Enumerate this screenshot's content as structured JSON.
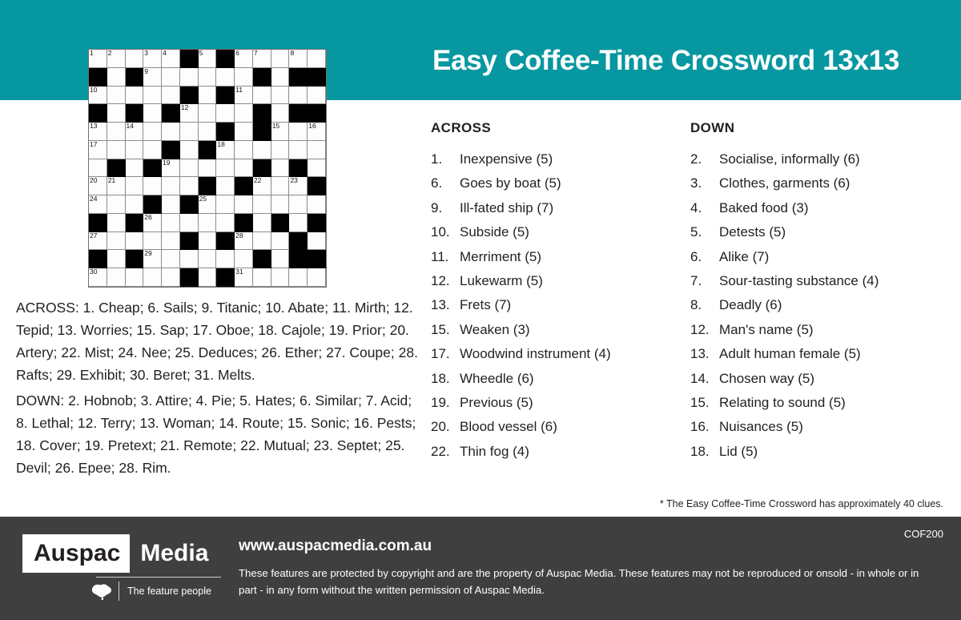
{
  "header": {
    "title": "Easy Coffee-Time Crossword 13x13",
    "background_color": "#0797a0"
  },
  "grid": {
    "size": 13,
    "black_cells": [
      [
        0,
        5
      ],
      [
        0,
        7
      ],
      [
        1,
        0
      ],
      [
        1,
        2
      ],
      [
        1,
        9
      ],
      [
        1,
        11
      ],
      [
        1,
        12
      ],
      [
        2,
        5
      ],
      [
        2,
        7
      ],
      [
        3,
        0
      ],
      [
        3,
        2
      ],
      [
        3,
        4
      ],
      [
        3,
        9
      ],
      [
        3,
        11
      ],
      [
        3,
        12
      ],
      [
        4,
        7
      ],
      [
        4,
        9
      ],
      [
        5,
        4
      ],
      [
        5,
        6
      ],
      [
        6,
        1
      ],
      [
        6,
        3
      ],
      [
        6,
        9
      ],
      [
        6,
        11
      ],
      [
        7,
        6
      ],
      [
        7,
        8
      ],
      [
        7,
        12
      ],
      [
        8,
        3
      ],
      [
        8,
        5
      ],
      [
        9,
        0
      ],
      [
        9,
        2
      ],
      [
        9,
        8
      ],
      [
        9,
        10
      ],
      [
        9,
        12
      ],
      [
        10,
        5
      ],
      [
        10,
        7
      ],
      [
        10,
        11
      ],
      [
        11,
        0
      ],
      [
        11,
        2
      ],
      [
        11,
        9
      ],
      [
        11,
        11
      ],
      [
        11,
        12
      ],
      [
        12,
        5
      ],
      [
        12,
        7
      ]
    ],
    "numbers": [
      {
        "r": 0,
        "c": 0,
        "n": "1"
      },
      {
        "r": 0,
        "c": 1,
        "n": "2"
      },
      {
        "r": 0,
        "c": 3,
        "n": "3"
      },
      {
        "r": 0,
        "c": 4,
        "n": "4"
      },
      {
        "r": 0,
        "c": 6,
        "n": "5"
      },
      {
        "r": 0,
        "c": 8,
        "n": "6"
      },
      {
        "r": 0,
        "c": 9,
        "n": "7"
      },
      {
        "r": 0,
        "c": 11,
        "n": "8"
      },
      {
        "r": 1,
        "c": 3,
        "n": "9"
      },
      {
        "r": 2,
        "c": 0,
        "n": "10"
      },
      {
        "r": 2,
        "c": 8,
        "n": "11"
      },
      {
        "r": 3,
        "c": 5,
        "n": "12"
      },
      {
        "r": 4,
        "c": 0,
        "n": "13"
      },
      {
        "r": 4,
        "c": 2,
        "n": "14"
      },
      {
        "r": 4,
        "c": 10,
        "n": "15"
      },
      {
        "r": 4,
        "c": 12,
        "n": "16"
      },
      {
        "r": 5,
        "c": 0,
        "n": "17"
      },
      {
        "r": 5,
        "c": 7,
        "n": "18"
      },
      {
        "r": 6,
        "c": 4,
        "n": "19"
      },
      {
        "r": 7,
        "c": 0,
        "n": "20"
      },
      {
        "r": 7,
        "c": 1,
        "n": "21"
      },
      {
        "r": 7,
        "c": 9,
        "n": "22"
      },
      {
        "r": 7,
        "c": 11,
        "n": "23"
      },
      {
        "r": 8,
        "c": 0,
        "n": "24"
      },
      {
        "r": 8,
        "c": 6,
        "n": "25"
      },
      {
        "r": 9,
        "c": 3,
        "n": "26"
      },
      {
        "r": 10,
        "c": 0,
        "n": "27"
      },
      {
        "r": 10,
        "c": 8,
        "n": "28"
      },
      {
        "r": 11,
        "c": 3,
        "n": "29"
      },
      {
        "r": 12,
        "c": 0,
        "n": "30"
      },
      {
        "r": 12,
        "c": 8,
        "n": "31"
      }
    ]
  },
  "answers": {
    "across_line": "ACROSS: 1. Cheap;  6. Sails;  9. Titanic;  10. Abate;  11. Mirth;  12. Tepid;  13. Worries;  15. Sap;  17. Oboe;  18. Cajole;  19. Prior;  20. Artery;  22. Mist;  24. Nee;  25. Deduces;  26. Ether;  27. Coupe;  28. Rafts;  29. Exhibit;  30. Beret;  31. Melts.",
    "down_line": "DOWN: 2. Hobnob;  3. Attire;  4. Pie;  5. Hates;  6. Similar;  7. Acid;  8. Lethal;  12. Terry;  13. Woman;  14. Route;  15. Sonic;  16. Pests;  18. Cover;  19. Pretext;  21. Remote;  22. Mutual;  23. Septet;  25. Devil;  26. Epee;  28. Rim."
  },
  "clues": {
    "across_heading": "ACROSS",
    "down_heading": "DOWN",
    "across": [
      {
        "num": "1.",
        "text": "Inexpensive (5)"
      },
      {
        "num": "6.",
        "text": "Goes by boat (5)"
      },
      {
        "num": "9.",
        "text": "Ill-fated ship (7)"
      },
      {
        "num": "10.",
        "text": "Subside (5)"
      },
      {
        "num": "11.",
        "text": "Merriment (5)"
      },
      {
        "num": "12.",
        "text": "Lukewarm (5)"
      },
      {
        "num": "13.",
        "text": "Frets (7)"
      },
      {
        "num": "15.",
        "text": "Weaken (3)"
      },
      {
        "num": "17.",
        "text": "Woodwind instrument (4)"
      },
      {
        "num": "18.",
        "text": "Wheedle (6)"
      },
      {
        "num": "19.",
        "text": "Previous (5)"
      },
      {
        "num": "20.",
        "text": "Blood vessel (6)"
      },
      {
        "num": "22.",
        "text": "Thin fog (4)"
      }
    ],
    "down": [
      {
        "num": "2.",
        "text": "Socialise, informally (6)"
      },
      {
        "num": "3.",
        "text": "Clothes, garments (6)"
      },
      {
        "num": "4.",
        "text": "Baked food (3)"
      },
      {
        "num": "5.",
        "text": "Detests (5)"
      },
      {
        "num": "6.",
        "text": "Alike (7)"
      },
      {
        "num": "7.",
        "text": "Sour-tasting substance (4)"
      },
      {
        "num": "8.",
        "text": "Deadly (6)"
      },
      {
        "num": "12.",
        "text": "Man's name (5)"
      },
      {
        "num": "13.",
        "text": "Adult human female (5)"
      },
      {
        "num": "14.",
        "text": "Chosen way (5)"
      },
      {
        "num": "15.",
        "text": "Relating to sound (5)"
      },
      {
        "num": "16.",
        "text": "Nuisances (5)"
      },
      {
        "num": "18.",
        "text": "Lid (5)"
      }
    ]
  },
  "footnote": "* The Easy Coffee-Time Crossword has approximately 40 clues.",
  "footer": {
    "logo_name": "Auspac",
    "logo_media": "Media",
    "tagline": "The feature people",
    "url": "www.auspacmedia.com.au",
    "copyright": "These features are protected by copyright and are the property of Auspac Media. These features may not be reproduced or onsold - in whole or in part - in any form without the written permission of Auspac Media.",
    "doc_code": "COF200",
    "background_color": "#3f3f3f"
  }
}
